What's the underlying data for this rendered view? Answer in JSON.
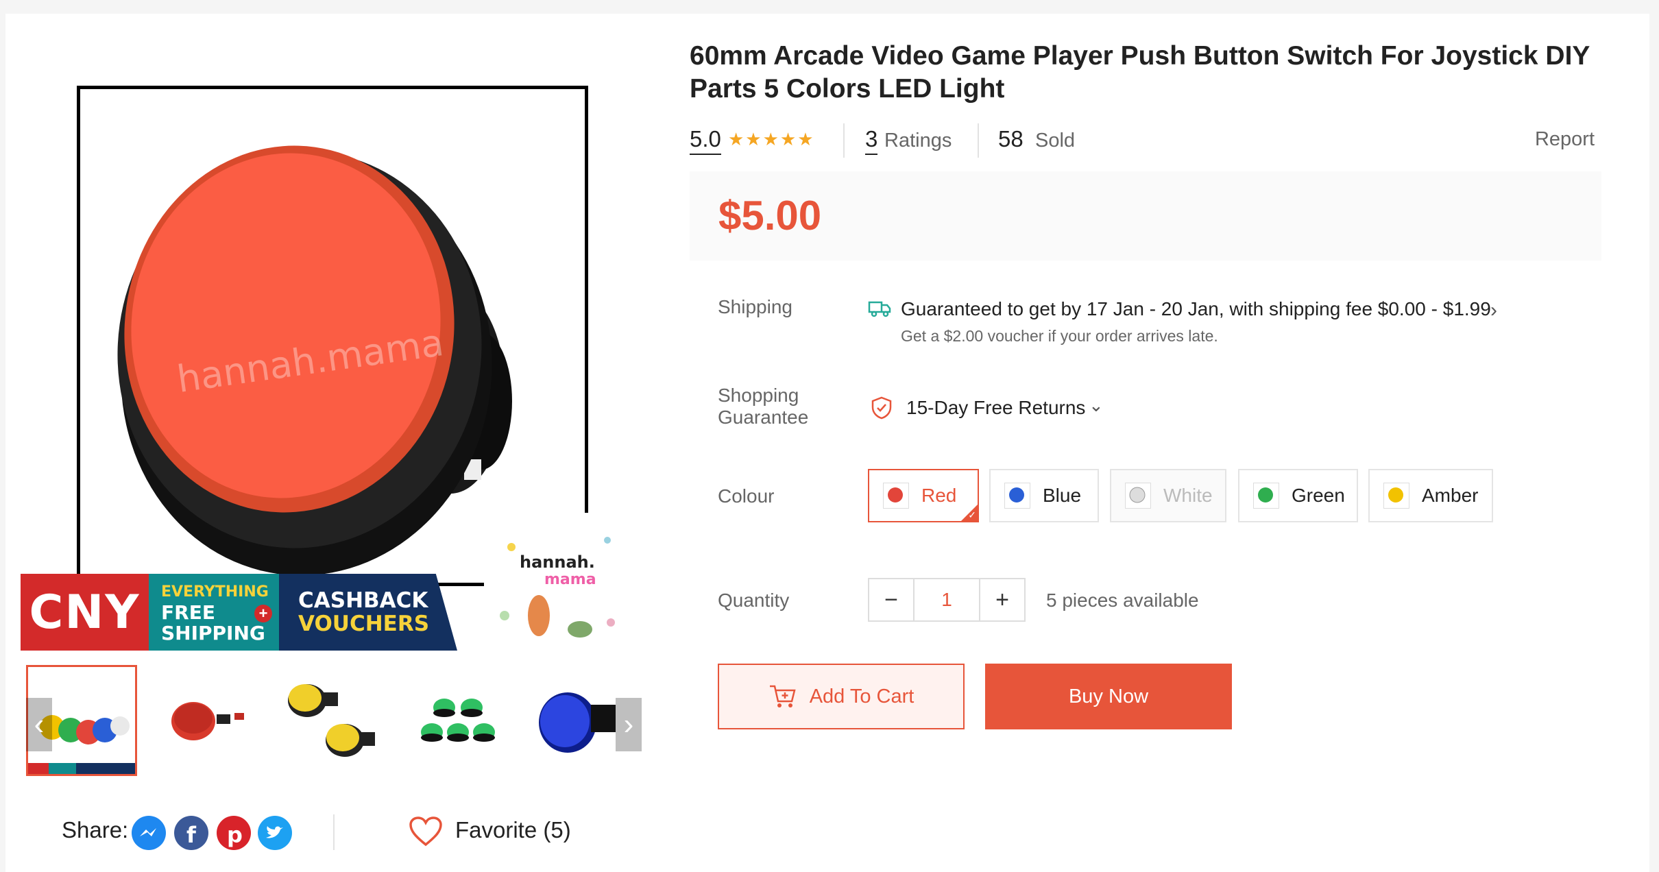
{
  "product": {
    "title": "60mm Arcade Video Game Player Push Button Switch For Joystick DIY Parts 5 Colors LED Light",
    "rating": "5.0",
    "stars": "★★★★★",
    "ratings_count": "3",
    "ratings_label": "Ratings",
    "sold_count": "58",
    "sold_label": "Sold",
    "report_label": "Report",
    "price": "$5.00"
  },
  "image": {
    "watermark": "hannah.mama",
    "banner": {
      "cny": "CNY",
      "line1": "EVERYTHING",
      "line2": "FREE",
      "line3": "SHIPPING",
      "cash1": "CASHBACK",
      "cash2": "VOUCHERS",
      "plus": "+"
    },
    "logo": {
      "line1": "hannah.",
      "line2": "mama"
    }
  },
  "shipping": {
    "label": "Shipping",
    "main": "Guaranteed to get by 17 Jan - 20 Jan, with shipping fee $0.00 - $1.99",
    "sub": "Get a $2.00 voucher if your order arrives late.",
    "chevron": "›"
  },
  "guarantee": {
    "label_1": "Shopping",
    "label_2": "Guarantee",
    "returns": "15-Day Free Returns",
    "chevron": "⌄"
  },
  "colour": {
    "label": "Colour",
    "options": [
      {
        "name": "Red",
        "swatch": "#e2453a",
        "state": "selected"
      },
      {
        "name": "Blue",
        "swatch": "#2a5fd6",
        "state": "normal"
      },
      {
        "name": "White",
        "swatch": "#dddddd",
        "state": "disabled"
      },
      {
        "name": "Green",
        "swatch": "#2fae4f",
        "state": "normal"
      },
      {
        "name": "Amber",
        "swatch": "#f2c200",
        "state": "normal"
      }
    ]
  },
  "quantity": {
    "label": "Quantity",
    "minus": "−",
    "value": "1",
    "plus": "+",
    "available": "5 pieces available"
  },
  "actions": {
    "add_to_cart": "Add To Cart",
    "buy_now": "Buy Now"
  },
  "share": {
    "label": "Share:",
    "favorite": "Favorite (5)"
  },
  "thumbs_nav": {
    "prev": "‹",
    "next": "›"
  },
  "colors": {
    "accent": "#e7553a",
    "star": "#f5a623"
  }
}
